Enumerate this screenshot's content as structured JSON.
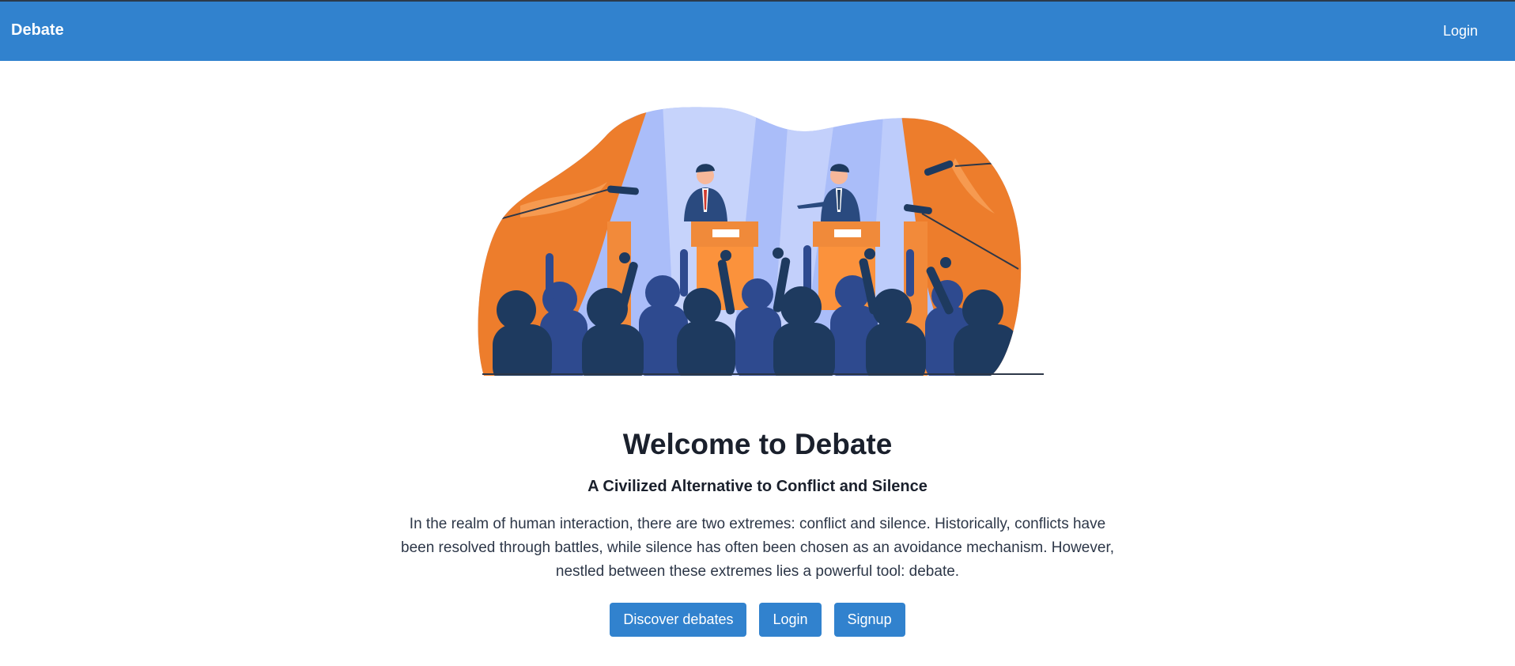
{
  "navbar": {
    "brand": "Debate",
    "login_label": "Login"
  },
  "hero": {
    "illustration_name": "debate-stage-illustration",
    "title": "Welcome to Debate",
    "subtitle": "A Civilized Alternative to Conflict and Silence",
    "description": "In the realm of human interaction, there are two extremes: conflict and silence. Historically, conflicts have been resolved through battles, while silence has often been chosen as an avoidance mechanism. However, nestled between these extremes lies a powerful tool: debate."
  },
  "actions": {
    "discover_label": "Discover debates",
    "login_label": "Login",
    "signup_label": "Signup"
  },
  "colors": {
    "primary": "#3182ce",
    "curtain_orange": "#ed7d2c",
    "podium_orange": "#fb923c",
    "audience_navy": "#1e3a5f",
    "stage_light_blue": "#aabdf9"
  }
}
